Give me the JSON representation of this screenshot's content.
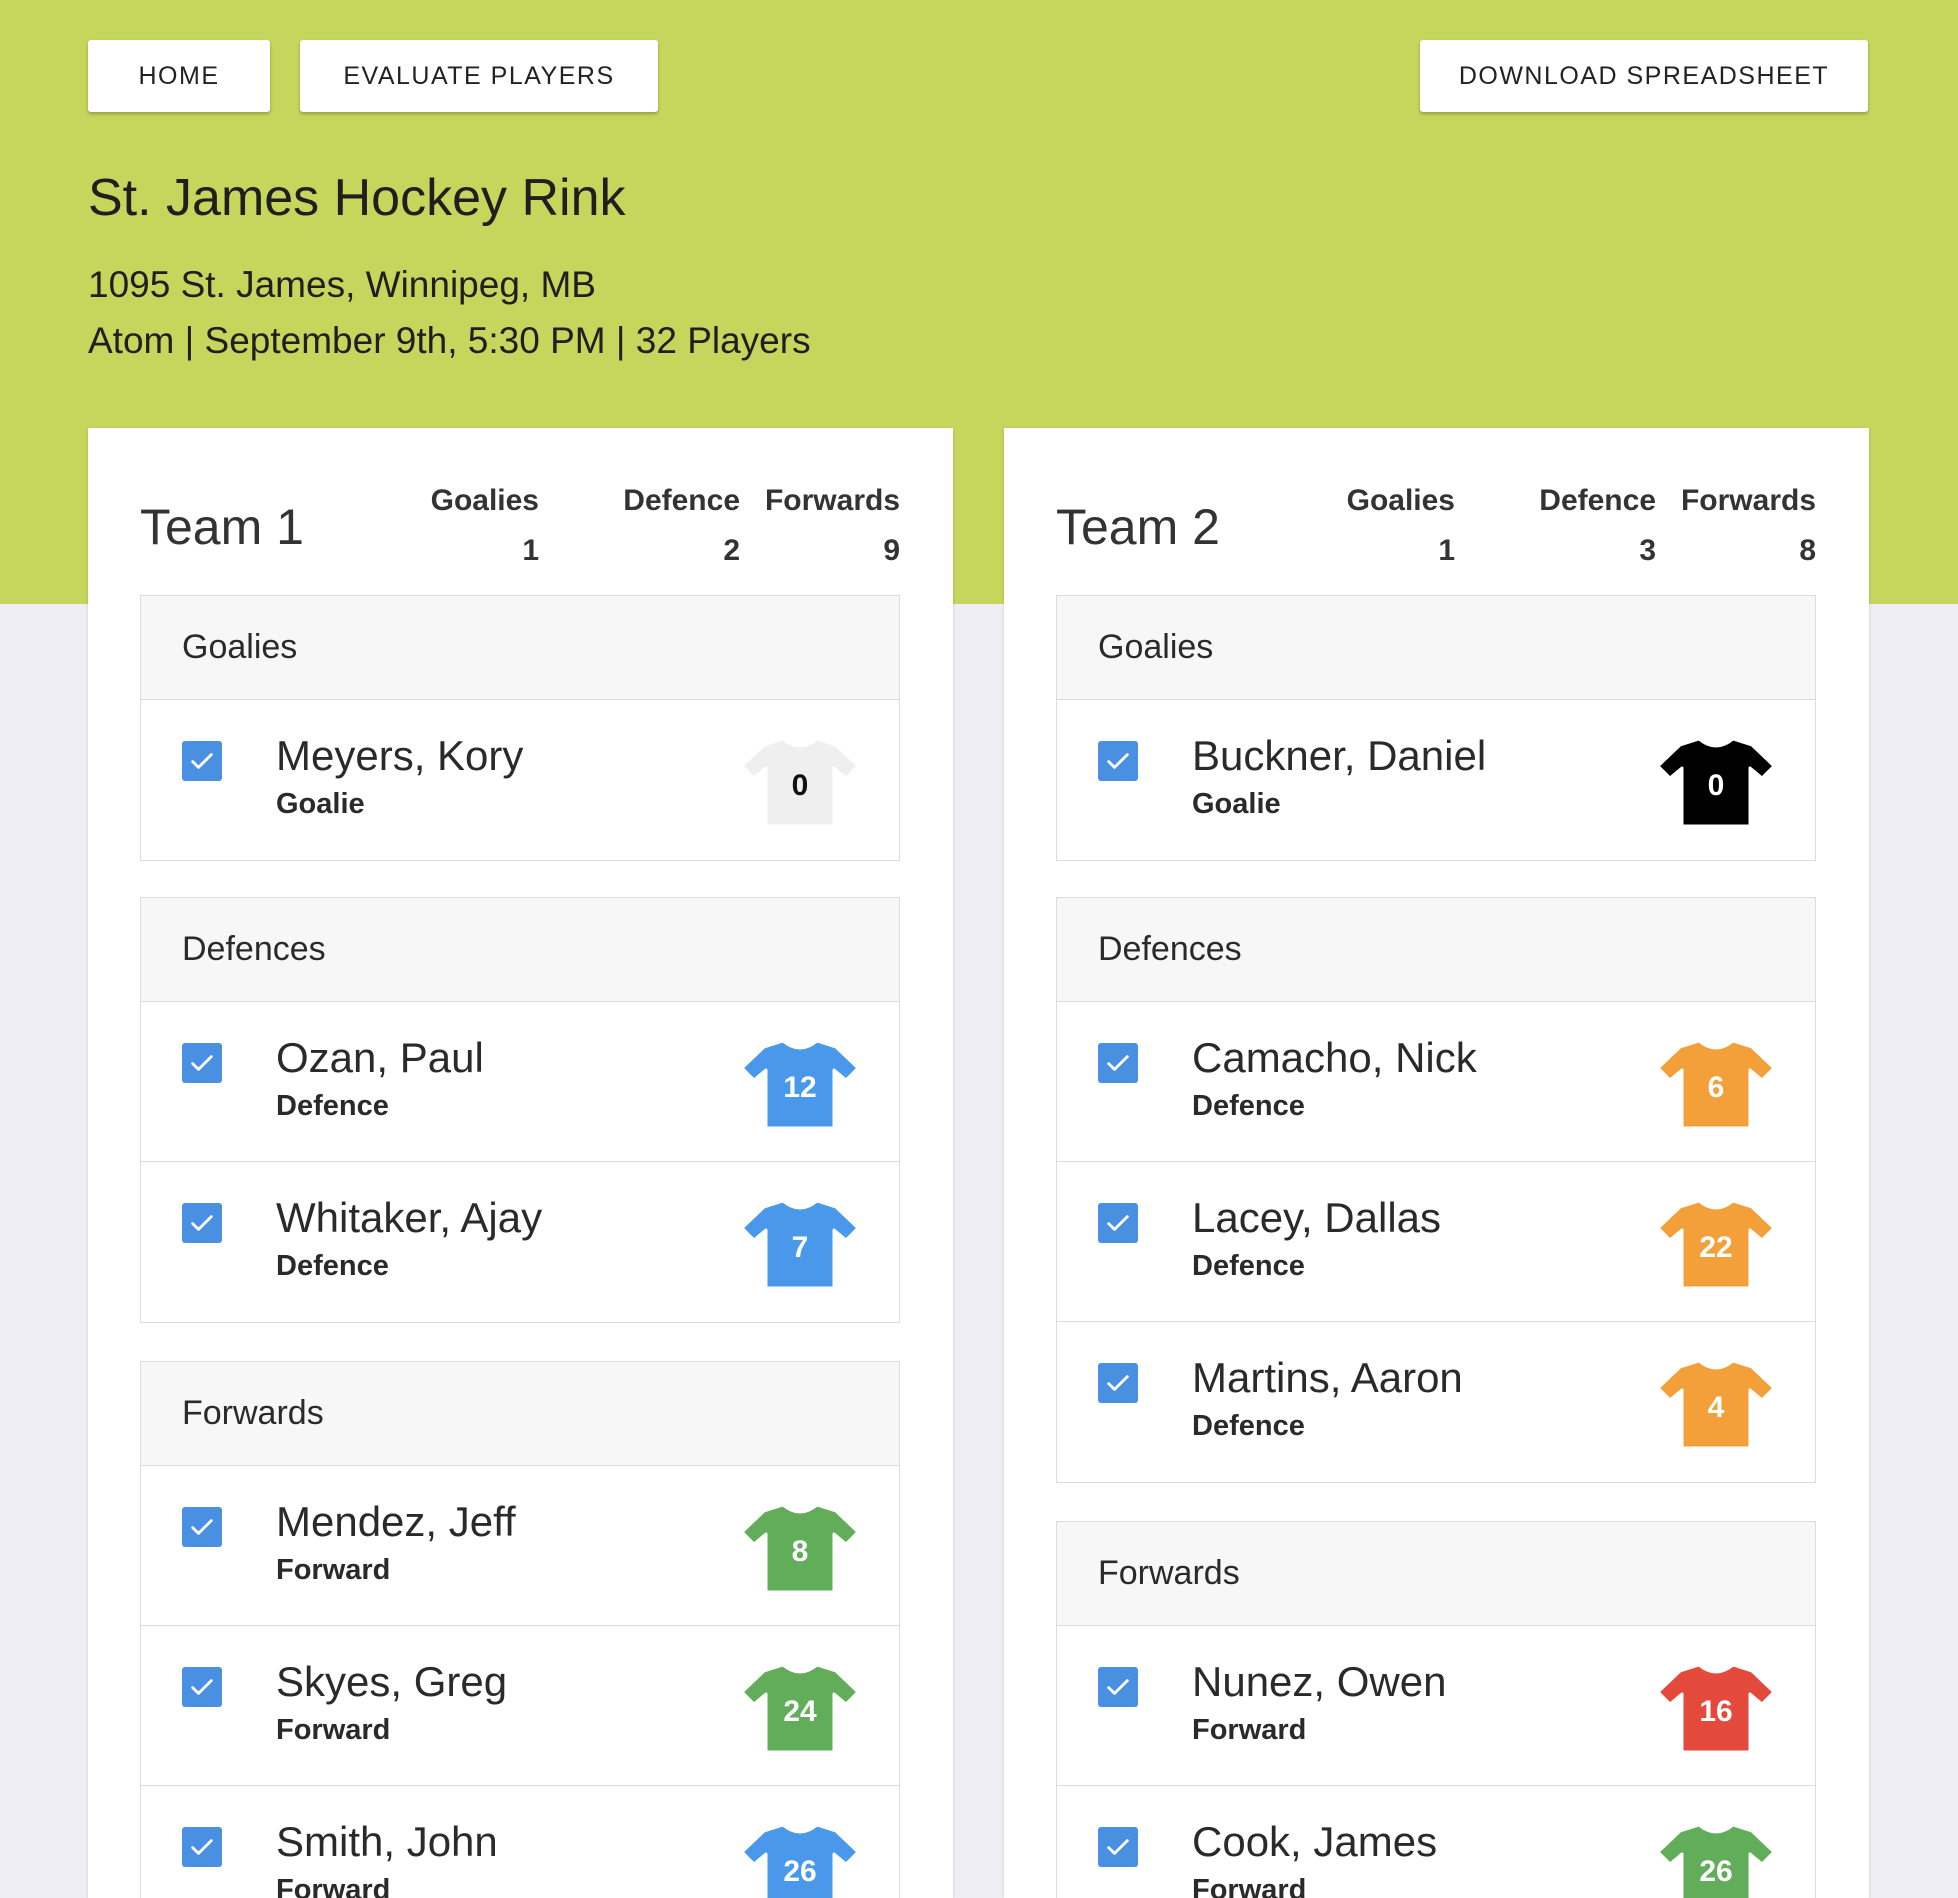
{
  "nav": {
    "home": "HOME",
    "evaluate": "EVALUATE PLAYERS",
    "download": "DOWNLOAD SPREADSHEET"
  },
  "venue": {
    "name": "St. James Hockey Rink",
    "address": "1095 St. James, Winnipeg, MB",
    "details": "Atom | September 9th, 5:30 PM | 32 Players"
  },
  "colors": {
    "hero": "#c4d65c",
    "checkbox": "#4a90e2",
    "jersey_white": "#efefef",
    "jersey_black": "#000000",
    "jersey_blue": "#4a98ea",
    "jersey_orange": "#f4a03a",
    "jersey_green": "#62ad5a",
    "jersey_red": "#e44a3c"
  },
  "teams": [
    {
      "title": "Team 1",
      "stats": {
        "goalies_label": "Goalies",
        "goalies": "1",
        "defence_label": "Defence",
        "defence": "2",
        "forwards_label": "Forwards",
        "forwards": "9"
      },
      "groups": {
        "goalies": {
          "title": "Goalies",
          "players": [
            {
              "name": "Meyers, Kory",
              "position": "Goalie",
              "number": "0",
              "jersey_color": "#efefef",
              "number_color": "#111111",
              "checked": true
            }
          ]
        },
        "defences": {
          "title": "Defences",
          "players": [
            {
              "name": "Ozan, Paul",
              "position": "Defence",
              "number": "12",
              "jersey_color": "#4a98ea",
              "number_color": "#ffffff",
              "checked": true
            },
            {
              "name": "Whitaker, Ajay",
              "position": "Defence",
              "number": "7",
              "jersey_color": "#4a98ea",
              "number_color": "#ffffff",
              "checked": true
            }
          ]
        },
        "forwards": {
          "title": "Forwards",
          "players": [
            {
              "name": "Mendez, Jeff",
              "position": "Forward",
              "number": "8",
              "jersey_color": "#62ad5a",
              "number_color": "#ffffff",
              "checked": true
            },
            {
              "name": "Skyes, Greg",
              "position": "Forward",
              "number": "24",
              "jersey_color": "#62ad5a",
              "number_color": "#ffffff",
              "checked": true
            },
            {
              "name": "Smith, John",
              "position": "Forward",
              "number": "26",
              "jersey_color": "#4a98ea",
              "number_color": "#ffffff",
              "checked": true
            }
          ]
        }
      }
    },
    {
      "title": "Team 2",
      "stats": {
        "goalies_label": "Goalies",
        "goalies": "1",
        "defence_label": "Defence",
        "defence": "3",
        "forwards_label": "Forwards",
        "forwards": "8"
      },
      "groups": {
        "goalies": {
          "title": "Goalies",
          "players": [
            {
              "name": "Buckner, Daniel",
              "position": "Goalie",
              "number": "0",
              "jersey_color": "#000000",
              "number_color": "#ffffff",
              "checked": true
            }
          ]
        },
        "defences": {
          "title": "Defences",
          "players": [
            {
              "name": "Camacho, Nick",
              "position": "Defence",
              "number": "6",
              "jersey_color": "#f4a03a",
              "number_color": "#ffffff",
              "checked": true
            },
            {
              "name": "Lacey, Dallas",
              "position": "Defence",
              "number": "22",
              "jersey_color": "#f4a03a",
              "number_color": "#ffffff",
              "checked": true
            },
            {
              "name": "Martins, Aaron",
              "position": "Defence",
              "number": "4",
              "jersey_color": "#f4a03a",
              "number_color": "#ffffff",
              "checked": true
            }
          ]
        },
        "forwards": {
          "title": "Forwards",
          "players": [
            {
              "name": "Nunez, Owen",
              "position": "Forward",
              "number": "16",
              "jersey_color": "#e44a3c",
              "number_color": "#ffffff",
              "checked": true
            },
            {
              "name": "Cook, James",
              "position": "Forward",
              "number": "26",
              "jersey_color": "#62ad5a",
              "number_color": "#ffffff",
              "checked": true
            }
          ]
        }
      }
    }
  ]
}
